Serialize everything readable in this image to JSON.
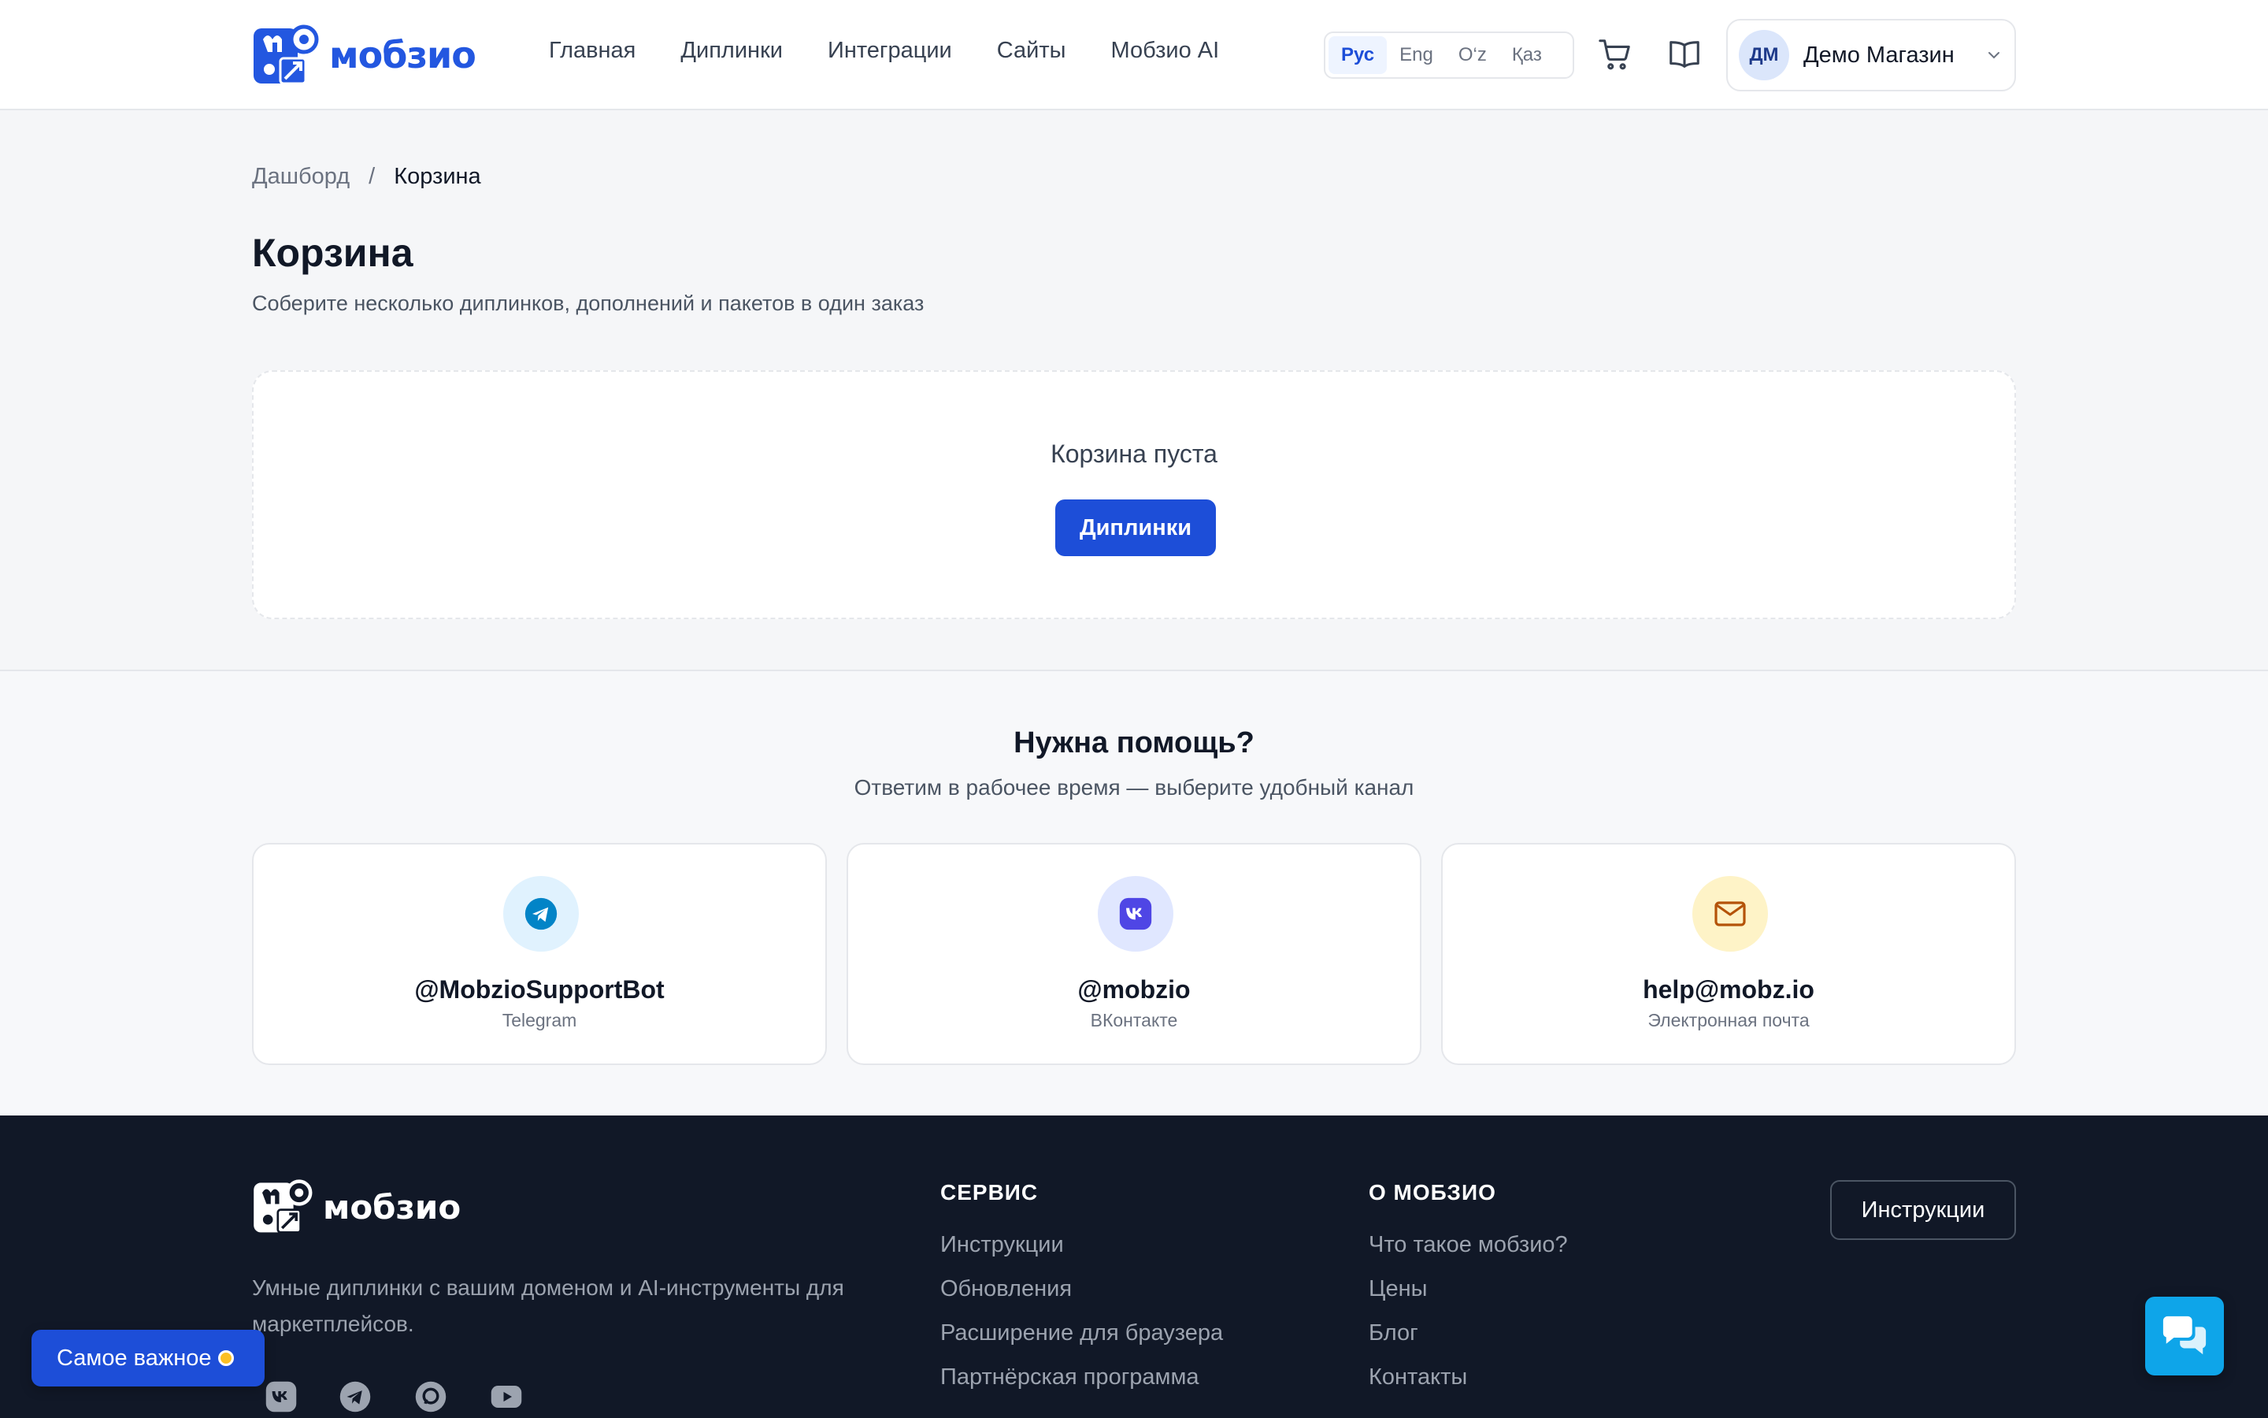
{
  "brand": {
    "name": "мобзио",
    "accent": "#1d4ed8"
  },
  "nav": {
    "items": [
      {
        "label": "Главная"
      },
      {
        "label": "Диплинки"
      },
      {
        "label": "Интеграции"
      },
      {
        "label": "Сайты"
      },
      {
        "label": "Мобзио AI"
      }
    ]
  },
  "languages": {
    "items": [
      {
        "label": "Рус",
        "active": true
      },
      {
        "label": "Eng",
        "active": false
      },
      {
        "label": "O‘z",
        "active": false
      },
      {
        "label": "Қаз",
        "active": false
      }
    ]
  },
  "header_icons": [
    "cart-icon",
    "book-icon"
  ],
  "user": {
    "initials": "ДМ",
    "name": "Демо Магазин"
  },
  "breadcrumb": {
    "parent": "Дашборд",
    "separator": "/",
    "current": "Корзина"
  },
  "page": {
    "title": "Корзина",
    "subtitle": "Соберите несколько диплинков, дополнений и пакетов в один заказ"
  },
  "cart": {
    "empty_text": "Корзина пуста",
    "button_label": "Диплинки"
  },
  "help": {
    "title": "Нужна помощь?",
    "subtitle": "Ответим в рабочее время — выберите удобный канал",
    "channels": [
      {
        "handle": "@MobzioSupportBot",
        "label": "Telegram",
        "icon": "telegram-icon",
        "bg": "#e0f2fe",
        "color": "#0284c7"
      },
      {
        "handle": "@mobzio",
        "label": "ВКонтакте",
        "icon": "vk-icon",
        "bg": "#e0e7ff",
        "color": "#4f46e5"
      },
      {
        "handle": "help@mobz.io",
        "label": "Электронная почта",
        "icon": "mail-icon",
        "bg": "#fef3c7",
        "color": "#b45309"
      }
    ]
  },
  "footer": {
    "brand": "мобзио",
    "description": "Умные диплинки с вашим доменом и AI-инструменты для маркетплейсов.",
    "service": {
      "title": "СЕРВИС",
      "links": [
        "Инструкции",
        "Обновления",
        "Расширение для браузера",
        "Партнёрская программа"
      ]
    },
    "about": {
      "title": "О МОБЗИО",
      "links": [
        "Что такое мобзио?",
        "Цены",
        "Блог",
        "Контакты"
      ]
    },
    "button_label": "Инструкции",
    "social": [
      "vk-icon",
      "telegram-icon",
      "chat-icon",
      "youtube-icon"
    ]
  },
  "floating": {
    "important_label": "Самое важное",
    "chat_icon": "chat-icon"
  }
}
